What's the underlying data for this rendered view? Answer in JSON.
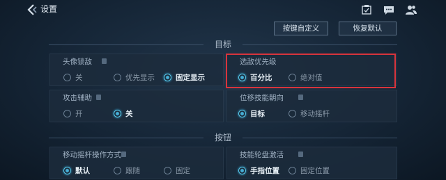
{
  "header": {
    "title": "设置",
    "actions": [
      {
        "name": "task-icon"
      },
      {
        "name": "chat-icon"
      },
      {
        "name": "friends-icon"
      }
    ]
  },
  "toolbar": {
    "keybind_label": "按键自定义",
    "reset_label": "恢复默认"
  },
  "sections": {
    "target_title": "目标",
    "buttons_title": "按钮"
  },
  "settings": {
    "avatar_lock": {
      "label": "头像锁敌",
      "options": [
        "关",
        "优先显示",
        "固定显示"
      ],
      "selected": 2
    },
    "target_priority": {
      "label": "选敌优先级",
      "options": [
        "百分比",
        "绝对值"
      ],
      "selected": 0
    },
    "attack_assist": {
      "label": "攻击辅助",
      "options": [
        "开",
        "关"
      ],
      "selected": 1
    },
    "skill_direction": {
      "label": "位移技能朝向",
      "options": [
        "目标",
        "移动摇杆"
      ],
      "selected": 0
    },
    "move_joystick": {
      "label": "移动摇杆操作方式",
      "options": [
        "默认",
        "跟随",
        "固定"
      ],
      "selected": 0
    },
    "skill_wheel": {
      "label": "技能轮盘激活",
      "options": [
        "手指位置",
        "固定位置"
      ],
      "selected": 0
    }
  },
  "colors": {
    "accent": "#46b0d8",
    "highlight": "#d8343c"
  }
}
